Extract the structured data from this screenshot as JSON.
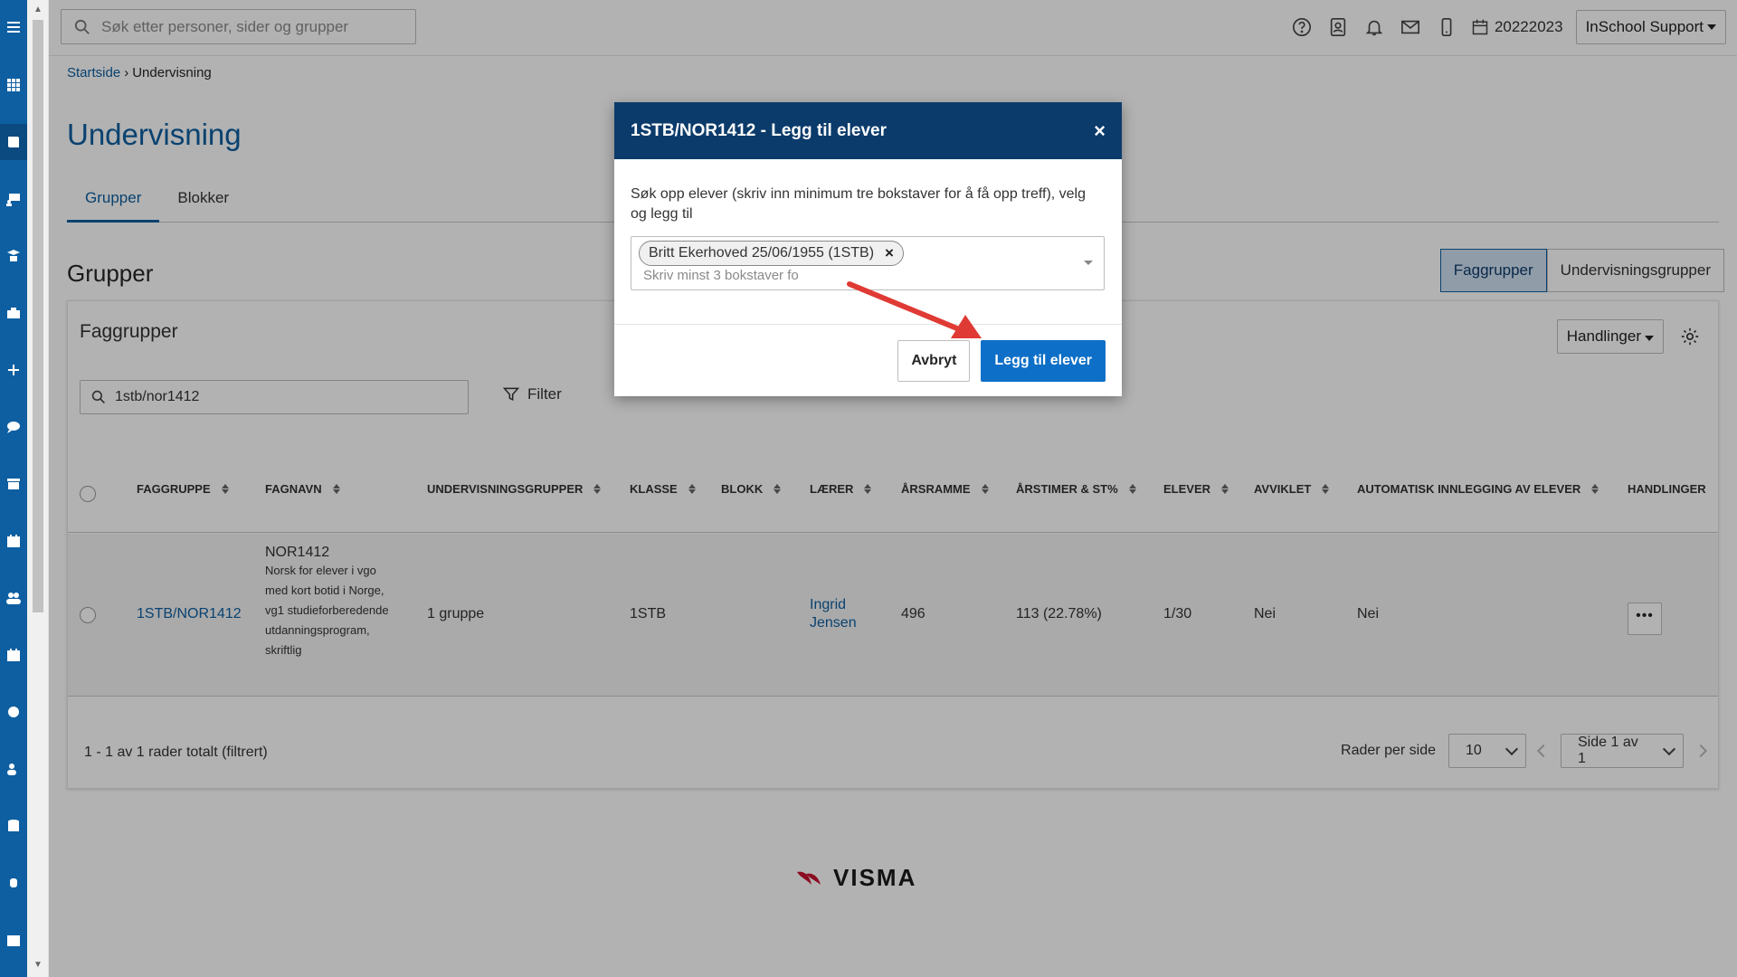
{
  "search": {
    "placeholder": "Søk etter personer, sider og grupper"
  },
  "header": {
    "school_year": "20222023",
    "user_menu": "InSchool Support"
  },
  "breadcrumb": {
    "home": "Startside",
    "current": "Undervisning"
  },
  "page": {
    "title": "Undervisning",
    "tabs": [
      {
        "label": "Grupper"
      },
      {
        "label": "Blokker"
      }
    ],
    "section_title": "Grupper",
    "toggle": [
      {
        "label": "Faggrupper"
      },
      {
        "label": "Undervisningsgrupper"
      }
    ]
  },
  "card": {
    "title": "Faggrupper",
    "actions_label": "Handlinger",
    "filter_value": "1stb/nor1412",
    "filter_label": "Filter",
    "columns": [
      "FAGGRUPPE",
      "FAGNAVN",
      "UNDERVISNINGSGRUPPER",
      "KLASSE",
      "BLOKK",
      "LÆRER",
      "ÅRSRAMME",
      "ÅRSTIMER & ST%",
      "ELEVER",
      "AVVIKLET",
      "AUTOMATISK INNLEGGING AV ELEVER",
      "HANDLINGER"
    ],
    "rows": [
      {
        "faggruppe": "1STB/NOR1412",
        "fagnavn_code": "NOR1412",
        "fagnavn_desc": "Norsk for elever i vgo med kort botid i Norge, vg1 studieforberedende utdanningsprogram, skriftlig",
        "undervisningsgrupper": "1 gruppe",
        "klasse": "1STB",
        "blokk": "",
        "laerer": "Ingrid Jensen",
        "arsramme": "496",
        "arstimer": "113 (22.78%)",
        "elever": "1/30",
        "avviklet": "Nei",
        "automatisk": "Nei"
      }
    ],
    "pager": {
      "info": "1 - 1 av 1 rader totalt (filtrert)",
      "rows_label": "Rader per side",
      "rows_value": "10",
      "page_value": "Side 1 av 1"
    }
  },
  "footer": {
    "brand": "VISMA"
  },
  "modal": {
    "title": "1STB/NOR1412 - Legg til elever",
    "close": "×",
    "instructions": "Søk opp elever (skriv inn minimum tre bokstaver for å få opp treff), velg og legg til",
    "selected_chip": "Britt Ekerhoved 25/06/1955 (1STB)",
    "chip_remove": "×",
    "input_placeholder": "Skriv minst 3 bokstaver fo",
    "cancel_label": "Avbryt",
    "submit_label": "Legg til elever"
  },
  "colors": {
    "brand_blue": "#0d5fa1",
    "modal_header": "#0b3b6b",
    "primary_button": "#0d6fc7",
    "annotation_arrow": "#e03a34"
  }
}
